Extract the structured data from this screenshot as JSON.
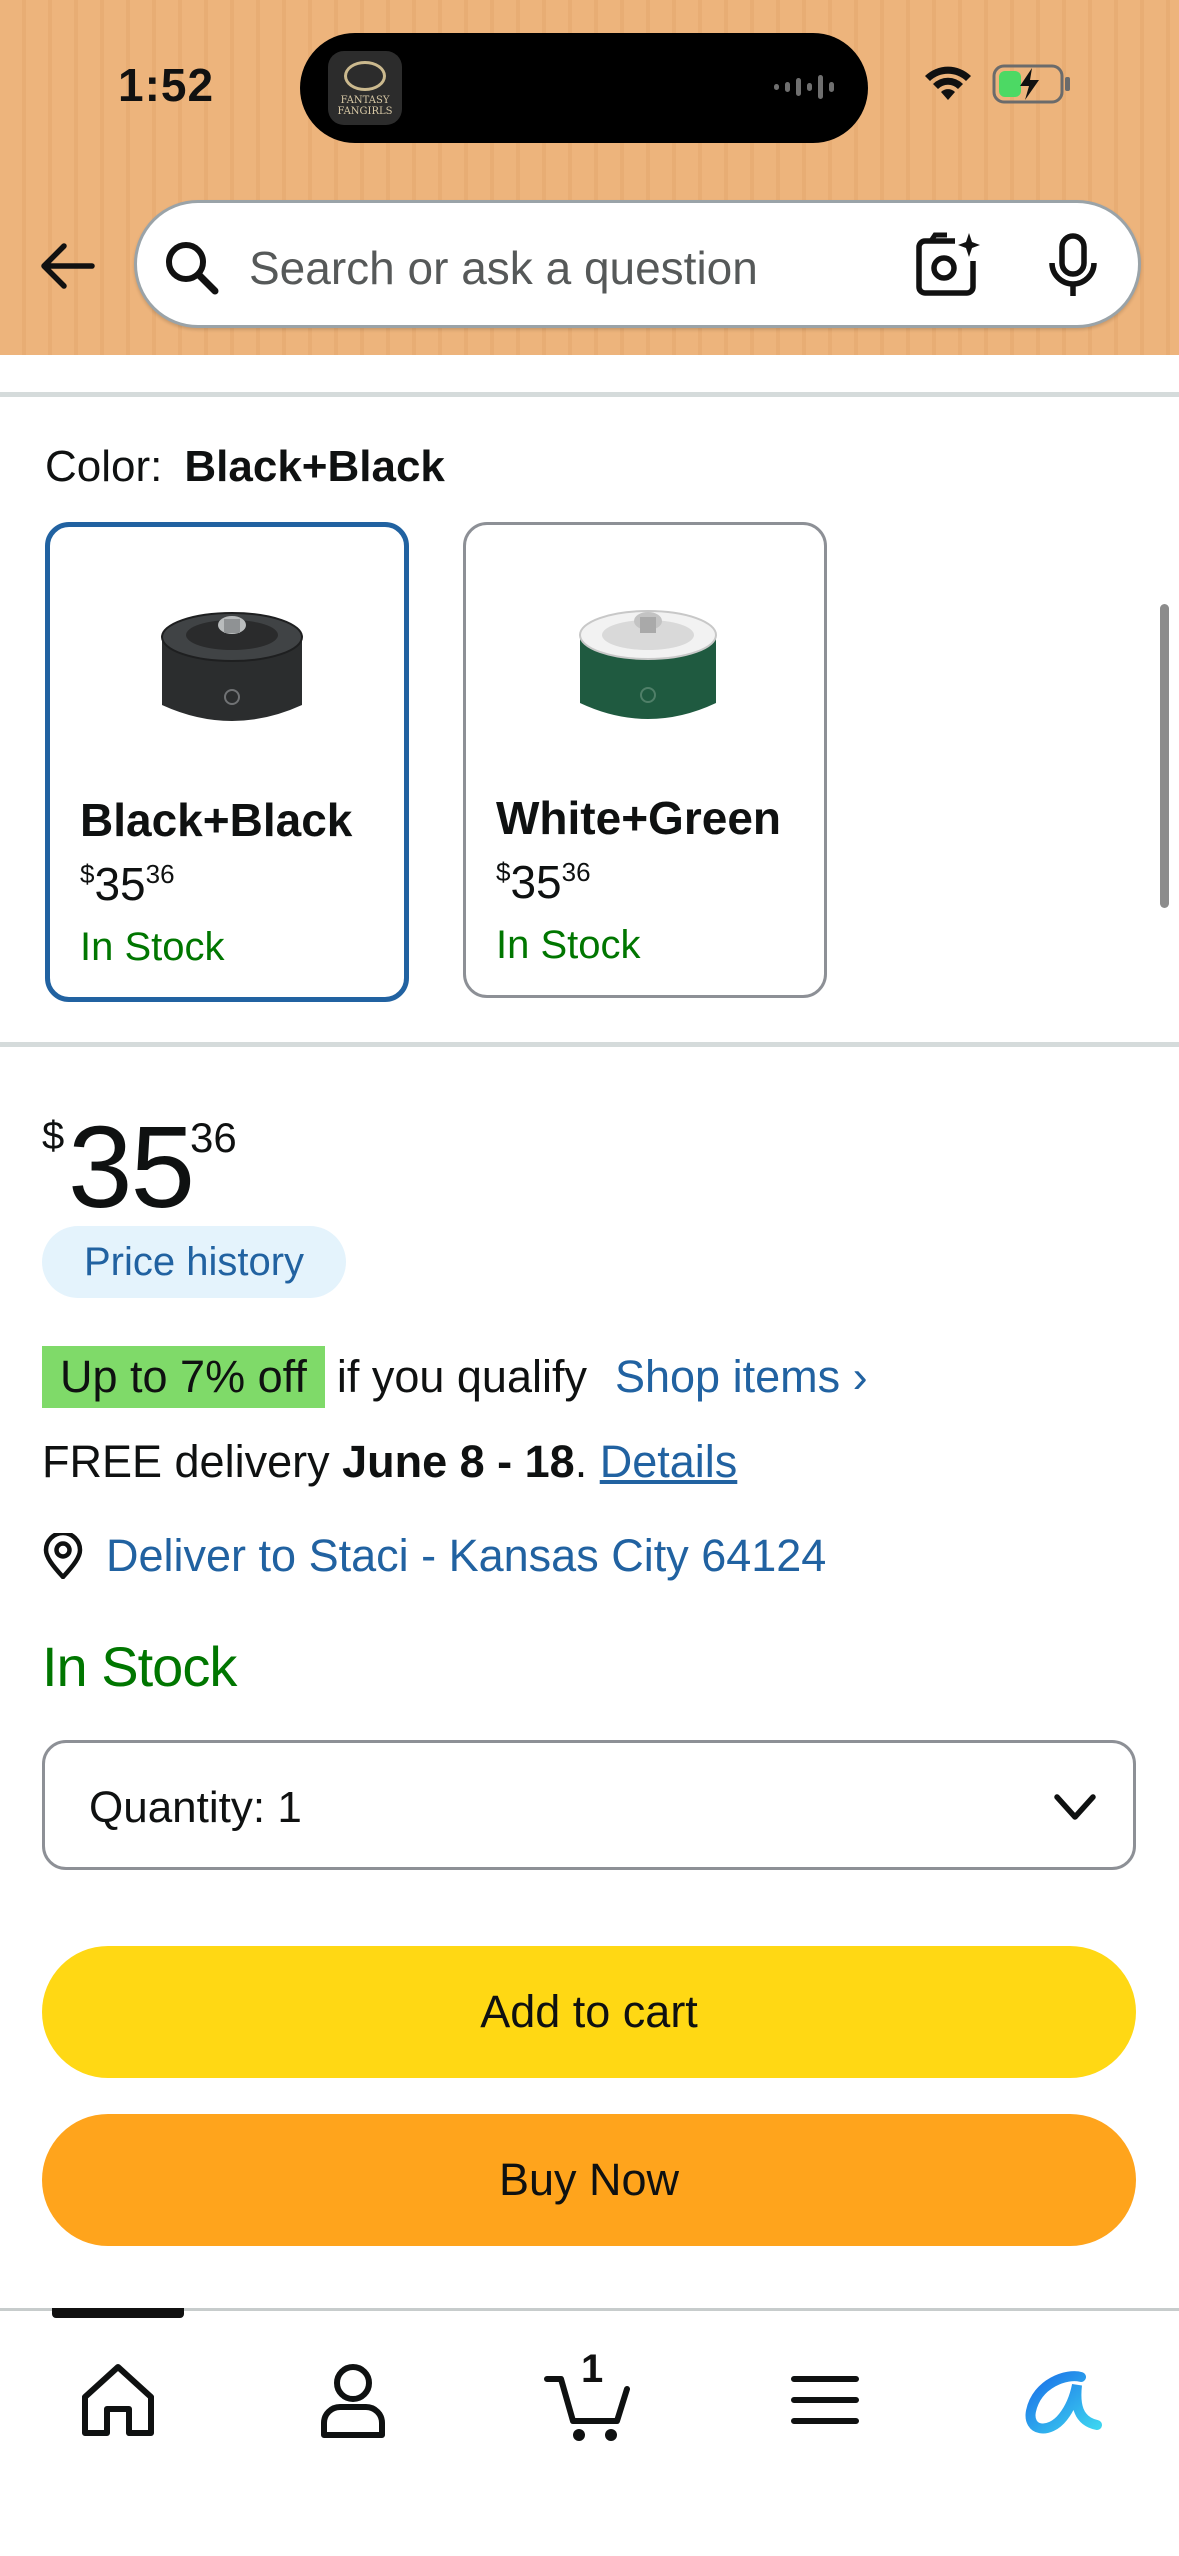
{
  "status_bar": {
    "time": "1:52",
    "island_app_name": "FANTASY FANGIRLS",
    "wifi_icon": "wifi-icon",
    "battery_icon": "battery-charging-icon",
    "battery_color": "#4cd964"
  },
  "header": {
    "background_color": "#edb47c",
    "back_icon": "back-arrow-icon",
    "search": {
      "placeholder": "Search or ask a question",
      "search_icon": "search-icon",
      "camera_icon": "camera-lens-icon",
      "mic_icon": "microphone-icon"
    }
  },
  "color_selector": {
    "label": "Color:",
    "selected_value": "Black+Black",
    "options": [
      {
        "name": "Black+Black",
        "price_whole": "35",
        "price_fraction": "36",
        "currency": "$",
        "stock": "In Stock",
        "selected": true,
        "body_color": "#2b2d2e",
        "lid_color": "#3a3c3d"
      },
      {
        "name": "White+Green",
        "price_whole": "35",
        "price_fraction": "36",
        "currency": "$",
        "stock": "In Stock",
        "selected": false,
        "body_color": "#1f5a40",
        "lid_color": "#eeeeee"
      }
    ]
  },
  "price": {
    "currency": "$",
    "whole": "35",
    "fraction": "36",
    "history_label": "Price history"
  },
  "deal": {
    "badge": "Up to 7% off",
    "text": "if you qualify",
    "link": "Shop items ›"
  },
  "delivery": {
    "prefix": "FREE delivery ",
    "dates": "June 8 - 18",
    "suffix": ". ",
    "details_link": "Details"
  },
  "deliver_to": {
    "icon": "location-pin-icon",
    "text": "Deliver to Staci - Kansas City 64124"
  },
  "stock_status": "In Stock",
  "quantity": {
    "label": "Quantity:",
    "value": "1"
  },
  "buttons": {
    "add_to_cart": "Add to cart",
    "buy_now": "Buy Now"
  },
  "bottom_nav": {
    "items": [
      {
        "icon": "home-icon",
        "active": true
      },
      {
        "icon": "account-icon",
        "active": false
      },
      {
        "icon": "cart-icon",
        "active": false,
        "count": "1"
      },
      {
        "icon": "menu-icon",
        "active": false
      },
      {
        "icon": "rufus-assistant-icon",
        "active": false
      }
    ]
  },
  "colors": {
    "link": "#2162a1",
    "in_stock": "#007600",
    "add_to_cart": "#ffd814",
    "buy_now": "#ffa41c",
    "deal_badge": "#7fda69",
    "selected_border": "#2162a1"
  }
}
